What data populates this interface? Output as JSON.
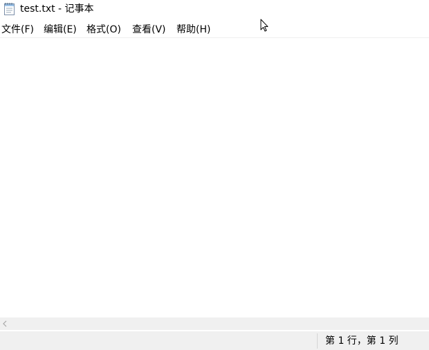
{
  "window": {
    "title": "test.txt - 记事本"
  },
  "menu": {
    "items": [
      {
        "label": "文件(F)"
      },
      {
        "label": "编辑(E)"
      },
      {
        "label": "格式(O)"
      },
      {
        "label": "查看(V)"
      },
      {
        "label": "帮助(H)"
      }
    ]
  },
  "editor": {
    "content": ""
  },
  "status_bar": {
    "position": "第 1 行，第 1 列"
  },
  "icons": {
    "app": "notepad-icon",
    "scroll_left": "chevron-left-icon",
    "cursor": "mouse-pointer-icon"
  },
  "colors": {
    "chrome_background": "#f0f0f0",
    "window_background": "#ffffff",
    "text": "#000000"
  }
}
